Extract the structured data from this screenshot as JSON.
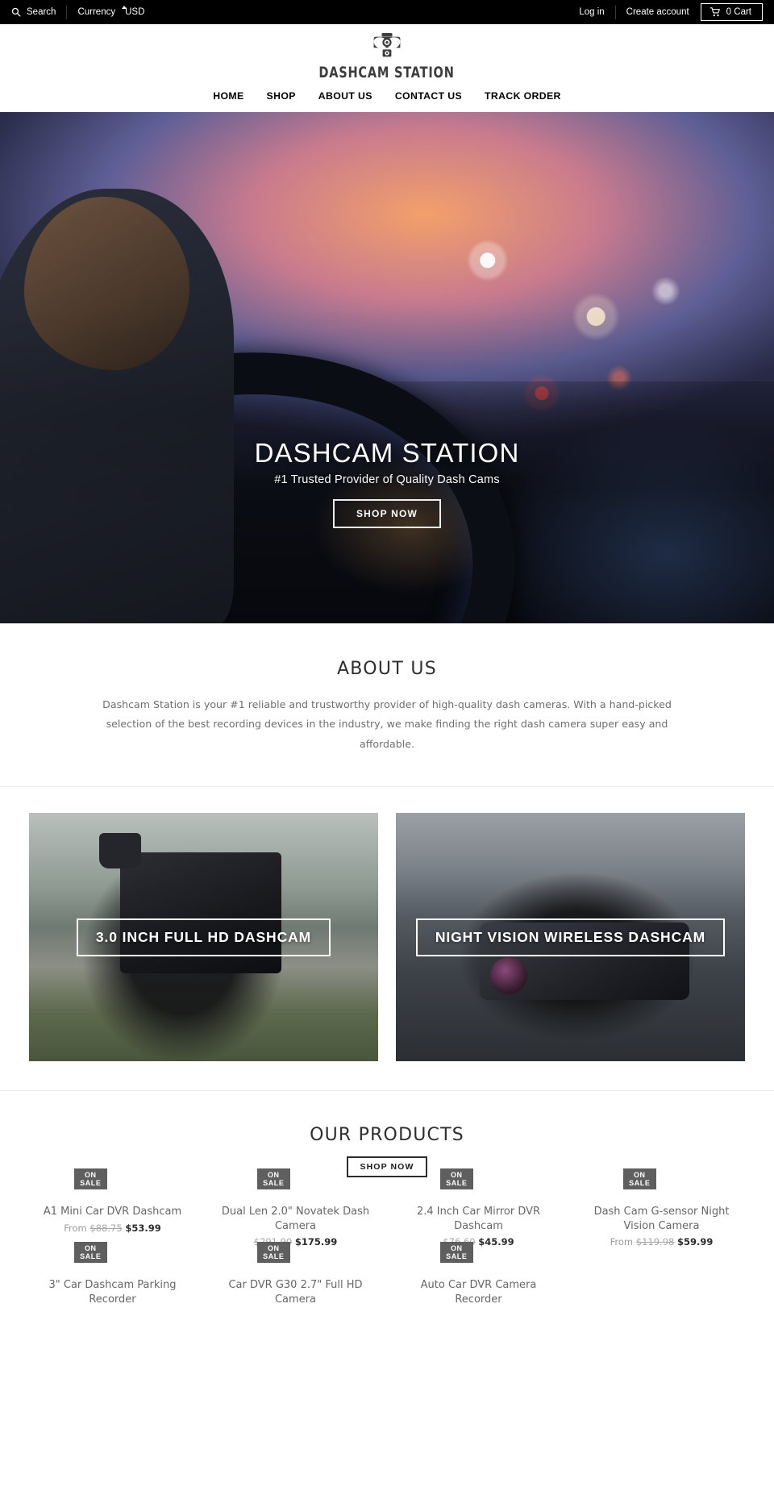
{
  "topbar": {
    "search_label": "Search",
    "search_icon": "search-icon",
    "currency_label": "Currency",
    "currency_value": "USD",
    "currency_options": [
      "USD"
    ],
    "login_label": "Log in",
    "create_account_label": "Create account",
    "cart_icon": "shopping-cart-icon",
    "cart_label": "0 Cart"
  },
  "header": {
    "logo_icon": "dashcam-camera-logo-icon",
    "logo_text": "DASHCAM STATION"
  },
  "nav": {
    "items": [
      {
        "label": "HOME"
      },
      {
        "label": "SHOP"
      },
      {
        "label": "ABOUT US"
      },
      {
        "label": "CONTACT US"
      },
      {
        "label": "TRACK ORDER"
      }
    ]
  },
  "hero": {
    "title": "DASHCAM STATION",
    "subtitle": "#1 Trusted Provider of Quality Dash Cams",
    "button_label": "SHOP NOW"
  },
  "about": {
    "heading": "ABOUT US",
    "body": "Dashcam Station is your #1 reliable and trustworthy provider of high-quality dash cameras. With a hand-picked selection of the best recording devices in the industry, we make finding the right dash camera super easy and affordable."
  },
  "collections": [
    {
      "label": "3.0 INCH FULL HD DASHCAM"
    },
    {
      "label": "NIGHT VISION WIRELESS DASHCAM"
    }
  ],
  "products_section": {
    "heading": "OUR PRODUCTS",
    "button_label": "SHOP NOW",
    "badge_label": "ON SALE",
    "items": [
      {
        "title": "A1 Mini Car DVR Dashcam",
        "from_label": "From",
        "old_price": "$88.75",
        "new_price": "$53.99",
        "badge": "ON SALE"
      },
      {
        "title": "Dual Len 2.0\" Novatek Dash Camera",
        "from_label": "",
        "old_price": "$291.90",
        "new_price": "$175.99",
        "badge": "ON SALE"
      },
      {
        "title": "2.4 Inch Car Mirror DVR Dashcam",
        "from_label": "",
        "old_price": "$76.60",
        "new_price": "$45.99",
        "badge": "ON SALE"
      },
      {
        "title": "Dash Cam G-sensor Night Vision Camera",
        "from_label": "From",
        "old_price": "$119.98",
        "new_price": "$59.99",
        "badge": "ON SALE"
      },
      {
        "title": "3\" Car Dashcam Parking Recorder",
        "from_label": "",
        "old_price": "",
        "new_price": "",
        "badge": "ON SALE"
      },
      {
        "title": "Car DVR G30 2.7\" Full HD Camera",
        "from_label": "",
        "old_price": "",
        "new_price": "",
        "badge": "ON SALE"
      },
      {
        "title": "Auto Car DVR Camera Recorder",
        "from_label": "",
        "old_price": "",
        "new_price": "",
        "badge": "ON SALE"
      }
    ]
  },
  "colors": {
    "topbar_bg": "#000000",
    "badge_bg": "#5f5f5f",
    "accent_text": "#2b2b2b",
    "muted_text": "#6f6f6f",
    "thumb_bg": "#f5f5f5"
  }
}
